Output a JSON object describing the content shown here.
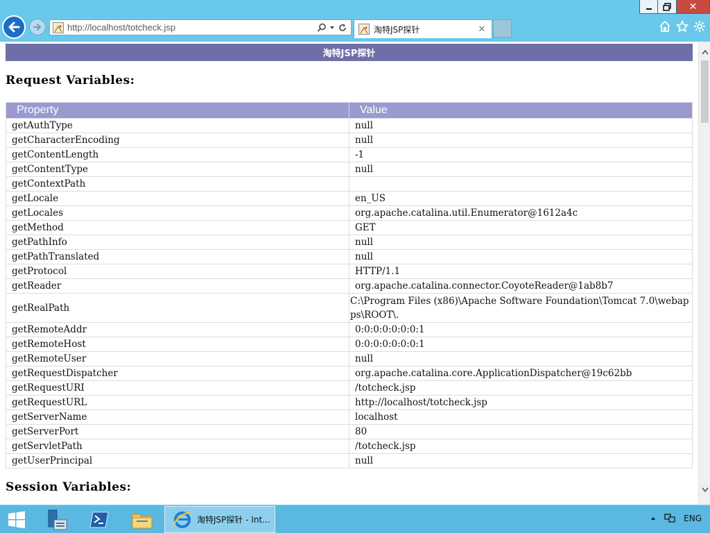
{
  "browser": {
    "url": "http://localhost/totcheck.jsp",
    "tab_title": "淘特JSP探针",
    "close_glyph": "✕",
    "min_glyph": "—",
    "tab_close_glyph": "✕"
  },
  "page": {
    "banner": "淘特JSP探针",
    "request_section_title": "Request Variables:",
    "session_section_title": "Session Variables:",
    "table_headers": {
      "property": "Property",
      "value": "Value"
    },
    "request_rows": [
      {
        "property": "getAuthType",
        "value": "null"
      },
      {
        "property": "getCharacterEncoding",
        "value": "null"
      },
      {
        "property": "getContentLength",
        "value": "-1"
      },
      {
        "property": "getContentType",
        "value": "null"
      },
      {
        "property": "getContextPath",
        "value": ""
      },
      {
        "property": "getLocale",
        "value": "en_US"
      },
      {
        "property": "getLocales",
        "value": "org.apache.catalina.util.Enumerator@1612a4c"
      },
      {
        "property": "getMethod",
        "value": "GET"
      },
      {
        "property": "getPathInfo",
        "value": "null"
      },
      {
        "property": "getPathTranslated",
        "value": "null"
      },
      {
        "property": "getProtocol",
        "value": "HTTP/1.1"
      },
      {
        "property": "getReader",
        "value": "org.apache.catalina.connector.CoyoteReader@1ab8b7"
      },
      {
        "property": "getRealPath",
        "value": "C:\\Program Files (x86)\\Apache Software Foundation\\Tomcat 7.0\\webapps\\ROOT\\."
      },
      {
        "property": "getRemoteAddr",
        "value": "0:0:0:0:0:0:0:1"
      },
      {
        "property": "getRemoteHost",
        "value": "0:0:0:0:0:0:0:1"
      },
      {
        "property": "getRemoteUser",
        "value": "null"
      },
      {
        "property": "getRequestDispatcher",
        "value": "org.apache.catalina.core.ApplicationDispatcher@19c62bb"
      },
      {
        "property": "getRequestURI",
        "value": "/totcheck.jsp"
      },
      {
        "property": "getRequestURL",
        "value": "http://localhost/totcheck.jsp"
      },
      {
        "property": "getServerName",
        "value": "localhost"
      },
      {
        "property": "getServerPort",
        "value": "80"
      },
      {
        "property": "getServletPath",
        "value": "/totcheck.jsp"
      },
      {
        "property": "getUserPrincipal",
        "value": "null"
      }
    ]
  },
  "taskbar": {
    "active_task_label": "淘特JSP探针 - Int...",
    "language": "ENG"
  },
  "colors": {
    "banner_bg": "#6e6ea8",
    "header_bg": "#9a9ace",
    "chrome_bg": "#6ac8ea",
    "close_btn": "#c74b3f",
    "taskbar_bg": "#5bb8e0"
  },
  "icons": [
    "back-arrow-icon",
    "forward-arrow-icon",
    "favicon-icon",
    "search-icon",
    "dropdown-icon",
    "refresh-icon",
    "home-icon",
    "star-icon",
    "gear-icon",
    "windows-start-icon",
    "server-manager-icon",
    "powershell-icon",
    "file-explorer-icon",
    "internet-explorer-icon",
    "tray-arrow-icon",
    "network-icon"
  ]
}
